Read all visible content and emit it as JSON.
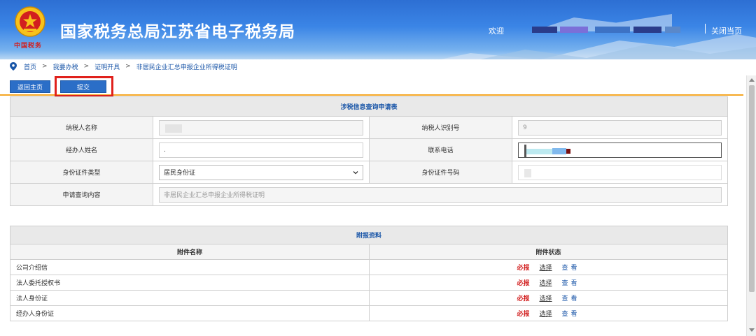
{
  "header": {
    "emblem_text": "中国税务",
    "site_title": "国家税务总局江苏省电子税务局",
    "welcome": "欢迎",
    "close_page": "关闭当页"
  },
  "breadcrumb": [
    "首页",
    "我要办税",
    "证明开具",
    "非居民企业汇总申报企业所得税证明"
  ],
  "breadcrumb_sep": ">",
  "toolbar": {
    "home_label": "返回主页",
    "submit_label": "提交"
  },
  "form": {
    "caption": "涉税信息查询申请表",
    "taxpayer_name_label": "纳税人名称",
    "taxpayer_id_label": "纳税人识别号",
    "taxpayer_id_value": "9",
    "agent_name_label": "经办人姓名",
    "agent_name_value": ".",
    "phone_label": "联系电话",
    "id_type_label": "身份证件类型",
    "id_type_value": "居民身份证",
    "id_number_label": "身份证件号码",
    "query_content_label": "申请查询内容",
    "query_content_value": "非居民企业汇总申报企业所得税证明"
  },
  "attachments": {
    "caption": "附报资料",
    "col_name": "附件名称",
    "col_status": "附件状态",
    "required_label": "必报",
    "choose_label": "选择",
    "view_label": "查看",
    "rows": [
      {
        "name": "公司介绍信"
      },
      {
        "name": "法人委托授权书"
      },
      {
        "name": "法人身份证"
      },
      {
        "name": "经办人身份证"
      }
    ]
  },
  "colors": {
    "primary": "#2b6ec7",
    "accent": "#f5a623",
    "required": "#d21f1f",
    "highlight": "#e0211c"
  }
}
